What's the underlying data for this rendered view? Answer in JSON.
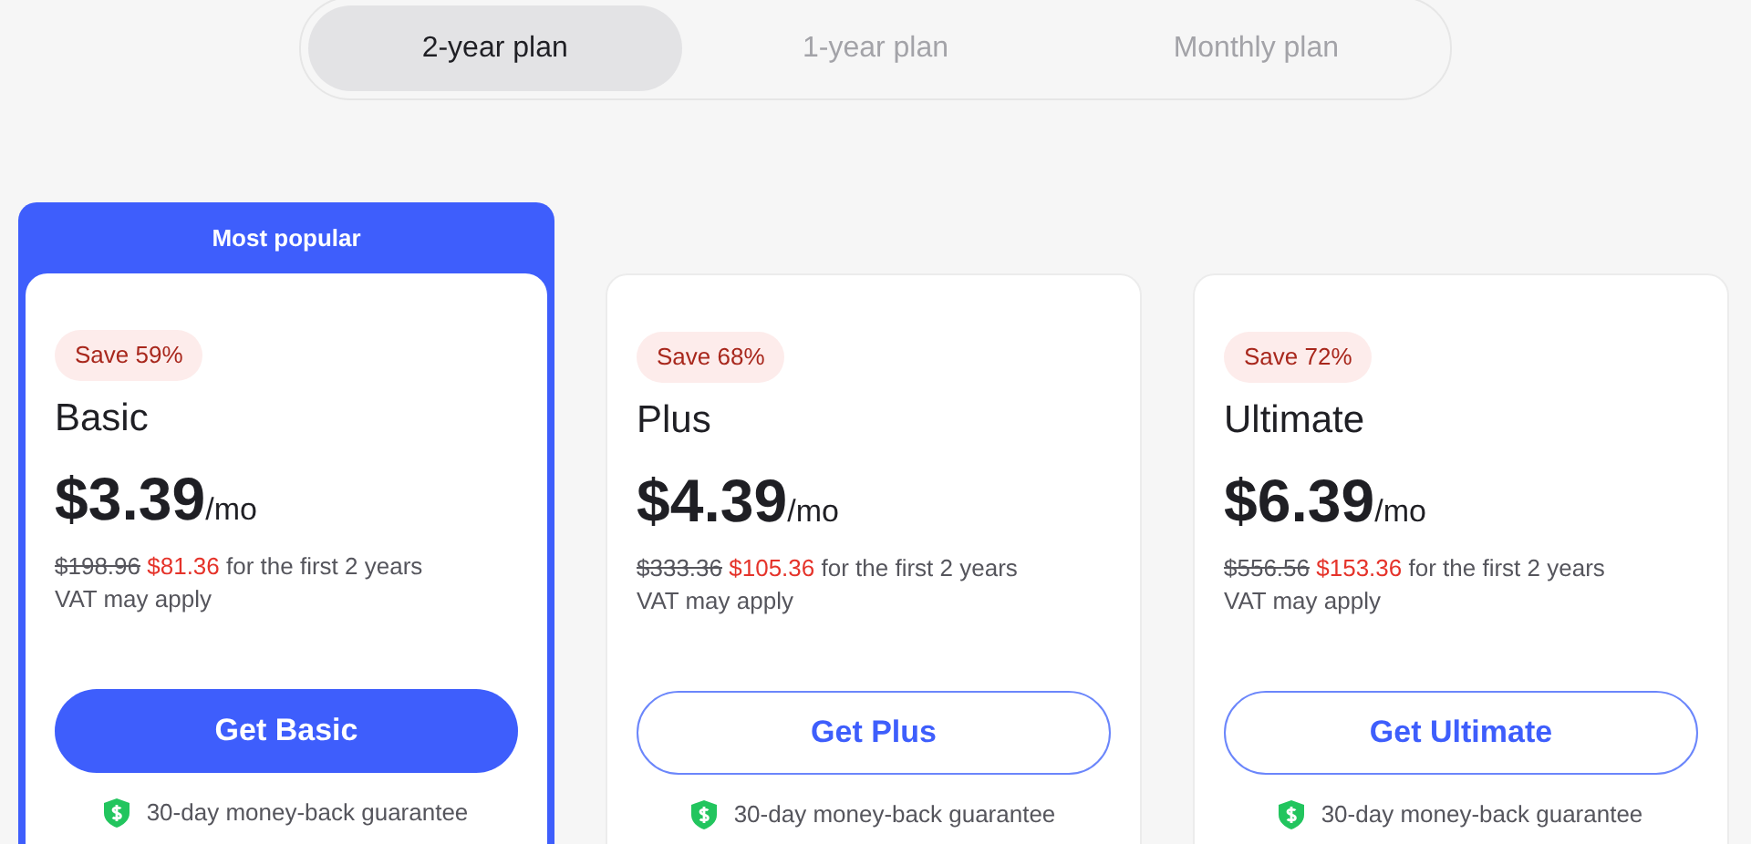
{
  "tabs": [
    {
      "label": "2-year plan",
      "selected": true
    },
    {
      "label": "1-year plan",
      "selected": false
    },
    {
      "label": "Monthly plan",
      "selected": false
    }
  ],
  "plans": [
    {
      "featured": true,
      "banner": "Most popular",
      "badge": "Save 59%",
      "name": "Basic",
      "price": "$3.39",
      "unit": "/mo",
      "old_price": "$198.96",
      "new_price": "$81.36",
      "term": "for the first 2 years",
      "note": "VAT may apply",
      "button": "Get Basic",
      "guarantee": "30-day money-back guarantee"
    },
    {
      "featured": false,
      "badge": "Save 68%",
      "name": "Plus",
      "price": "$4.39",
      "unit": "/mo",
      "old_price": "$333.36",
      "new_price": "$105.36",
      "term": "for the first 2 years",
      "note": "VAT may apply",
      "button": "Get Plus",
      "guarantee": "30-day money-back guarantee"
    },
    {
      "featured": false,
      "badge": "Save 72%",
      "name": "Ultimate",
      "price": "$6.39",
      "unit": "/mo",
      "old_price": "$556.56",
      "new_price": "$153.36",
      "term": "for the first 2 years",
      "note": "VAT may apply",
      "button": "Get Ultimate",
      "guarantee": "30-day money-back guarantee"
    }
  ]
}
